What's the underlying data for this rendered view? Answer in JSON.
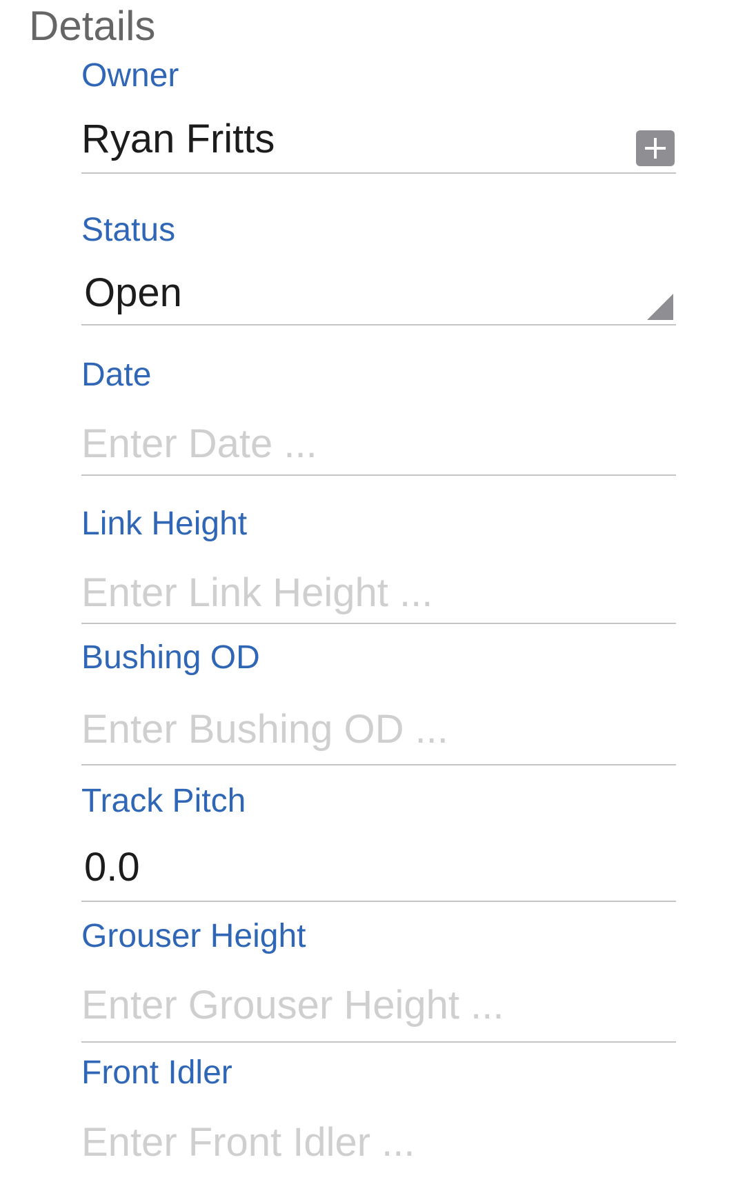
{
  "section": {
    "title": "Details"
  },
  "fields": {
    "owner": {
      "label": "Owner",
      "value": "Ryan Fritts"
    },
    "status": {
      "label": "Status",
      "value": "Open"
    },
    "date": {
      "label": "Date",
      "placeholder": "Enter Date ..."
    },
    "link_height": {
      "label": "Link Height",
      "placeholder": "Enter Link Height ..."
    },
    "bushing_od": {
      "label": "Bushing OD",
      "placeholder": "Enter Bushing OD ..."
    },
    "track_pitch": {
      "label": "Track Pitch",
      "value": "0.0"
    },
    "grouser_height": {
      "label": "Grouser Height",
      "placeholder": "Enter Grouser Height ..."
    },
    "front_idler": {
      "label": "Front Idler",
      "placeholder": "Enter Front Idler ..."
    }
  },
  "icons": {
    "owner_add": "plus-icon",
    "status_dropdown": "dropdown-triangle-icon"
  },
  "colors": {
    "label": "#2f66b6",
    "value": "#1c1c1c",
    "placeholder": "#cfcfcf",
    "divider": "#c4c4c4",
    "section_title": "#666666",
    "button": "#8e8e93"
  }
}
